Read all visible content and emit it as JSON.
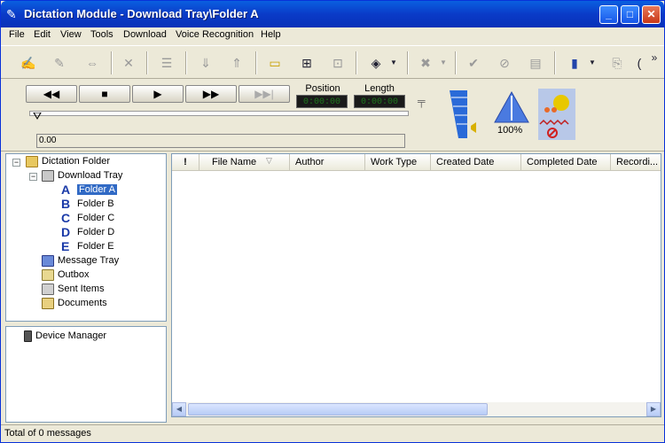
{
  "window": {
    "title": "Dictation Module - Download Tray\\Folder A",
    "controls": {
      "minimize": "_",
      "maximize": "□",
      "close": "✕"
    }
  },
  "menu": [
    "File",
    "Edit",
    "View",
    "Tools",
    "Download",
    "Voice Recognition",
    "Help"
  ],
  "toolbar": {
    "icons": [
      "dictate-icon",
      "edit-icon",
      "send-icon",
      "delete-icon",
      "properties-icon",
      "download-icon",
      "upload-icon",
      "folder-icon",
      "attachment-icon",
      "transcribe-icon",
      "voice-icon",
      "cancel-icon",
      "check-icon",
      "stop-icon",
      "book-icon",
      "device-icon",
      "settings-icon"
    ],
    "overflow": "»"
  },
  "player": {
    "rewind": "◀◀",
    "stop": "■",
    "play": "▶",
    "fast_forward": "▶▶",
    "end": "▶▶|",
    "position_label": "Position",
    "position_value": "0:00:00",
    "length_label": "Length",
    "length_value": "0:00:00",
    "time": "0.00",
    "speed": "100%",
    "position_fraction": 0
  },
  "tree": {
    "root": "Dictation Folder",
    "download_tray": "Download Tray",
    "folders": [
      {
        "letter": "A",
        "label": "Folder A"
      },
      {
        "letter": "B",
        "label": "Folder B"
      },
      {
        "letter": "C",
        "label": "Folder C"
      },
      {
        "letter": "D",
        "label": "Folder D"
      },
      {
        "letter": "E",
        "label": "Folder E"
      }
    ],
    "message_tray": "Message Tray",
    "outbox": "Outbox",
    "sent_items": "Sent Items",
    "documents": "Documents",
    "expand_symbol": "−"
  },
  "device_manager": "Device Manager",
  "list": {
    "columns": [
      "!",
      "File Name",
      "Author",
      "Work Type",
      "Created Date",
      "Completed Date",
      "Recordi..."
    ]
  },
  "status": "Total of 0 messages",
  "colors": {
    "title_bar": "#0a4fd8",
    "selection": "#316ac5",
    "window_bg": "#ece9d8"
  }
}
